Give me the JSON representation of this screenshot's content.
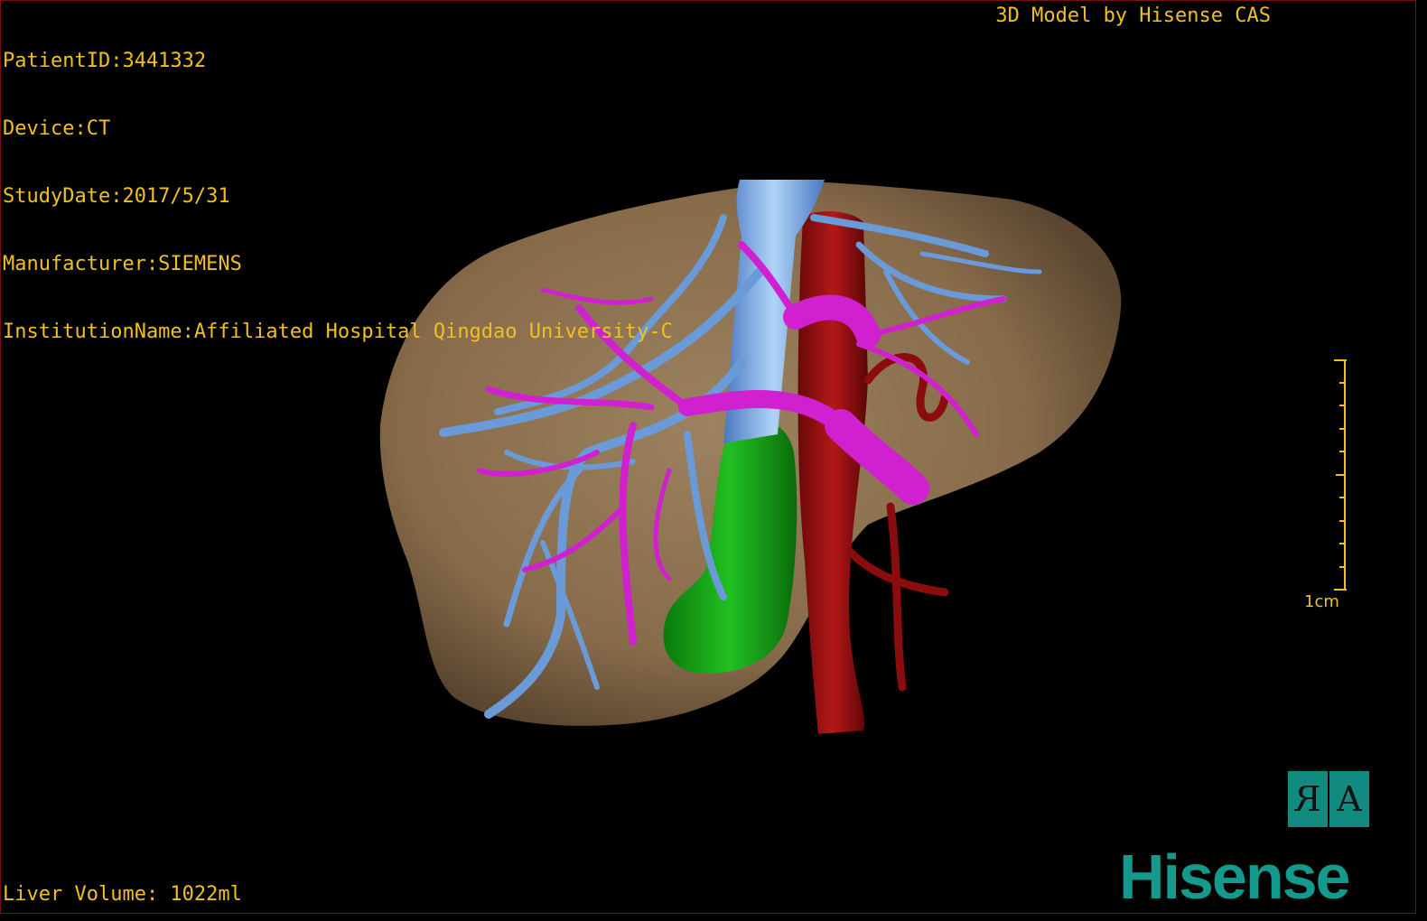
{
  "patient_info": {
    "patient_id": "PatientID:3441332",
    "device": "Device:CT",
    "study_date": "StudyDate:2017/5/31",
    "manufacturer": "Manufacturer:SIEMENS",
    "institution": "InstitutionName:Affiliated Hospital Qingdao University-C"
  },
  "credit": "3D Model by Hisense CAS",
  "liver_volume": "Liver Volume: 1022ml",
  "scale_bar": {
    "label": "1cm"
  },
  "orientation": {
    "left_glyph": "R",
    "right_glyph": "A"
  },
  "brand": "Hisense",
  "colors": {
    "hud_text": "#f0c020",
    "liver": "#8a7050",
    "hepatic_vein": "#6a9ad8",
    "portal_vein": "#d020d0",
    "artery": "#9a1010",
    "gallbladder": "#10a010",
    "brand": "#149a8c"
  }
}
